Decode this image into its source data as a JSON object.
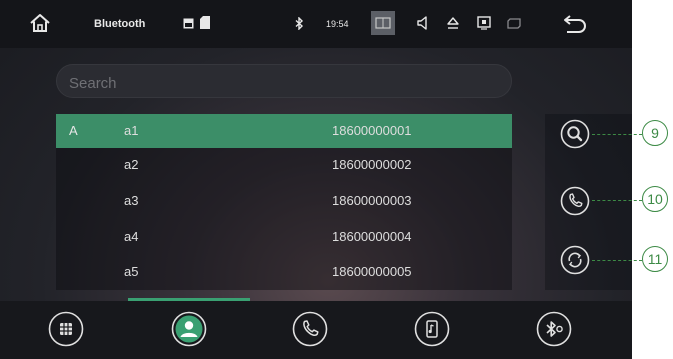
{
  "statusbar": {
    "app_title": "Bluetooth",
    "time": "19:54"
  },
  "search": {
    "placeholder": "Search",
    "value": ""
  },
  "contacts": [
    {
      "letter": "A",
      "name": "a1",
      "number": "18600000001",
      "selected": true
    },
    {
      "letter": "",
      "name": "a2",
      "number": "18600000002",
      "selected": false
    },
    {
      "letter": "",
      "name": "a3",
      "number": "18600000003",
      "selected": false
    },
    {
      "letter": "",
      "name": "a4",
      "number": "18600000004",
      "selected": false
    },
    {
      "letter": "",
      "name": "a5",
      "number": "18600000005",
      "selected": false
    }
  ],
  "side_actions": [
    {
      "icon": "search-icon",
      "callout": "9"
    },
    {
      "icon": "phone-icon",
      "callout": "10"
    },
    {
      "icon": "sync-icon",
      "callout": "11"
    }
  ],
  "bottom_nav": [
    {
      "icon": "keypad-icon"
    },
    {
      "icon": "contacts-icon",
      "active": true
    },
    {
      "icon": "call-log-icon"
    },
    {
      "icon": "music-icon"
    },
    {
      "icon": "bluetooth-settings-icon"
    }
  ],
  "colors": {
    "accent": "#3c8e68",
    "callout": "#3c8a45"
  }
}
